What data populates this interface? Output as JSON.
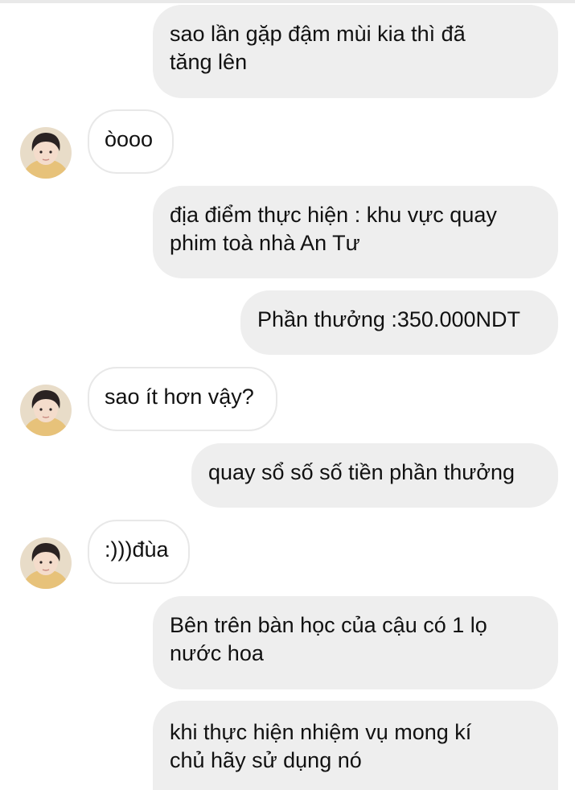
{
  "messages": [
    {
      "side": "sent",
      "text": "sao lần gặp đậm mùi kia thì đã\ntăng lên"
    },
    {
      "side": "received",
      "text": "òooo"
    },
    {
      "side": "sent",
      "text": "địa điểm thực hiện : khu vực quay\nphim toà nhà An Tư"
    },
    {
      "side": "sent",
      "text": "Phần thưởng :350.000NDT"
    },
    {
      "side": "received",
      "text": "sao ít hơn vậy?"
    },
    {
      "side": "sent",
      "text": "quay sổ số số tiền phần thưởng"
    },
    {
      "side": "received",
      "text": ":)))đùa"
    },
    {
      "side": "sent",
      "text": "Bên trên bàn học của cậu có 1 lọ\nnước hoa"
    },
    {
      "side": "sent",
      "text": "khi thực hiện nhiệm vụ mong kí\nchủ hãy sử dụng nó"
    }
  ],
  "colors": {
    "sent_bubble": "#eeeeee",
    "received_bubble": "#ffffff",
    "received_border": "#e8e8e8",
    "text": "#111111"
  },
  "icons": {
    "avatar": "contact-avatar-icon"
  }
}
